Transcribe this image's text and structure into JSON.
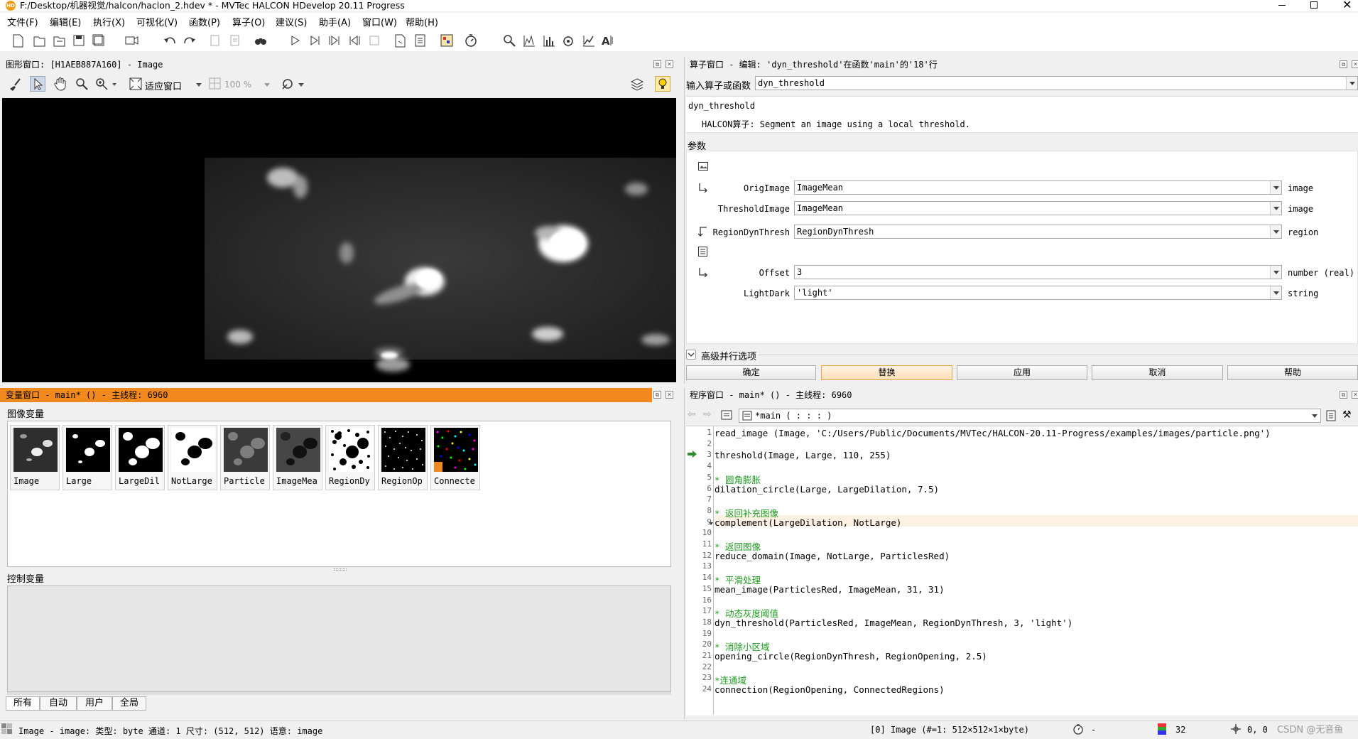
{
  "window": {
    "title": "F:/Desktop/机器视觉/halcon/haclon_2.hdev * - MVTec HALCON HDevelop 20.11 Progress"
  },
  "menu": [
    "文件(F)",
    "编辑(E)",
    "执行(X)",
    "可视化(V)",
    "函数(P)",
    "算子(O)",
    "建议(S)",
    "助手(A)",
    "窗口(W)",
    "帮助(H)"
  ],
  "graphics_window": {
    "title": "图形窗口: [H1AEB887A160] - Image",
    "fit_label": "适应窗口",
    "zoom": "100 %"
  },
  "operator_window": {
    "title": "算子窗口 - 编辑: 'dyn_threshold'在函数'main'的'18'行",
    "input_label": "输入算子或函数",
    "input_value": "dyn_threshold",
    "op_name": "dyn_threshold",
    "description": "HALCON算子: Segment an image using a local threshold.",
    "params_label": "参数",
    "params": [
      {
        "name": "OrigImage",
        "value": "ImageMean",
        "type": "image"
      },
      {
        "name": "ThresholdImage",
        "value": "ImageMean",
        "type": "image"
      },
      {
        "name": "RegionDynThresh",
        "value": "RegionDynThresh",
        "type": "region"
      },
      {
        "name": "Offset",
        "value": "3",
        "type": "number (real)"
      },
      {
        "name": "LightDark",
        "value": "'light'",
        "type": "string"
      }
    ],
    "advanced_label": "高级并行选项",
    "buttons": [
      "确定",
      "替换",
      "应用",
      "取消",
      "帮助"
    ]
  },
  "variable_window": {
    "title": "变量窗口 - main* () - 主线程: 6960",
    "iconic_label": "图像变量",
    "control_label": "控制变量",
    "thumbs": [
      "Image",
      "Large",
      "LargeDil",
      "NotLarge",
      "Particle",
      "ImageMea",
      "RegionDy",
      "RegionOp",
      "Connecte"
    ],
    "tabs": [
      "所有",
      "自动",
      "用户",
      "全局"
    ]
  },
  "program_window": {
    "title": "程序窗口 - main* () - 主线程: 6960",
    "proc": "*main ( : : : )",
    "lines": [
      {
        "n": "1",
        "code": "read_image (Image, 'C:/Users/Public/Documents/MVTec/HALCON-20.11-Progress/examples/images/particle.png')",
        "kind": "code"
      },
      {
        "n": "2",
        "code": "",
        "kind": "code"
      },
      {
        "n": "3",
        "code": "threshold(Image, Large, 110, 255)",
        "kind": "code"
      },
      {
        "n": "4",
        "code": "",
        "kind": "code"
      },
      {
        "n": "5",
        "code": "* 圆角膨胀",
        "kind": "comment"
      },
      {
        "n": "6",
        "code": "dilation_circle(Large, LargeDilation, 7.5)",
        "kind": "code"
      },
      {
        "n": "7",
        "code": "",
        "kind": "code"
      },
      {
        "n": "8",
        "code": "* 返回补充图像",
        "kind": "comment"
      },
      {
        "n": "9",
        "code": "complement(LargeDilation, NotLarge)",
        "kind": "code"
      },
      {
        "n": "10",
        "code": "",
        "kind": "code"
      },
      {
        "n": "11",
        "code": "* 返回图像",
        "kind": "comment"
      },
      {
        "n": "12",
        "code": "reduce_domain(Image, NotLarge, ParticlesRed)",
        "kind": "code"
      },
      {
        "n": "13",
        "code": "",
        "kind": "code"
      },
      {
        "n": "14",
        "code": "* 平滑处理",
        "kind": "comment"
      },
      {
        "n": "15",
        "code": "mean_image(ParticlesRed, ImageMean, 31, 31)",
        "kind": "code"
      },
      {
        "n": "16",
        "code": "",
        "kind": "code"
      },
      {
        "n": "17",
        "code": "* 动态灰度阈值",
        "kind": "comment"
      },
      {
        "n": "18",
        "code": "dyn_threshold(ParticlesRed, ImageMean, RegionDynThresh, 3, 'light')",
        "kind": "code"
      },
      {
        "n": "19",
        "code": "",
        "kind": "code"
      },
      {
        "n": "20",
        "code": "* 消除小区域",
        "kind": "comment"
      },
      {
        "n": "21",
        "code": "opening_circle(RegionDynThresh, RegionOpening, 2.5)",
        "kind": "code"
      },
      {
        "n": "22",
        "code": "",
        "kind": "code"
      },
      {
        "n": "23",
        "code": "*连通域",
        "kind": "comment"
      },
      {
        "n": "24",
        "code": "connection(RegionOpening, ConnectedRegions)",
        "kind": "code"
      }
    ]
  },
  "status": {
    "left": "Image - image: 类型: byte 通道: 1 尺寸: (512, 512) 语意: image",
    "image_info": "[0] Image (#=1: 512×512×1×byte)",
    "timer": "-",
    "gray": "32",
    "coords": "0, 0",
    "watermark": "CSDN @无音鱼"
  }
}
